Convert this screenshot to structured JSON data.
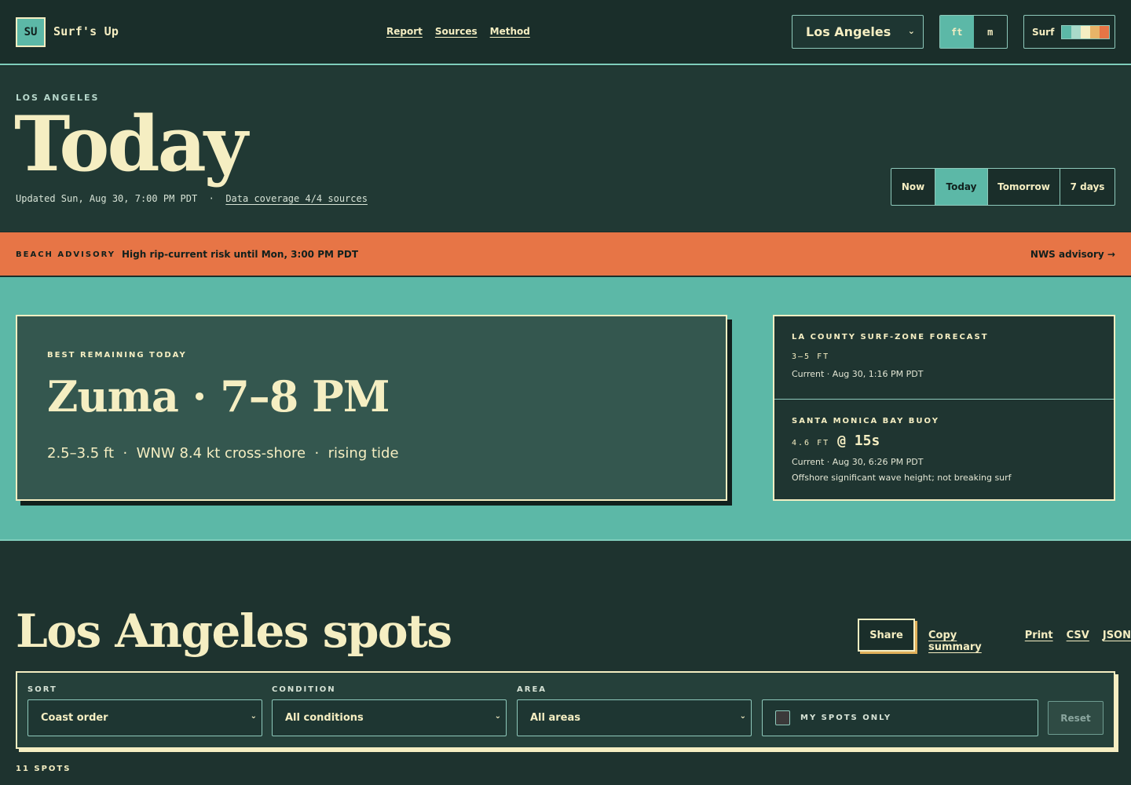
{
  "brand": {
    "logo": "SU",
    "name": "Surf's Up"
  },
  "nav": [
    {
      "label": "Report"
    },
    {
      "label": "Sources"
    },
    {
      "label": "Method"
    }
  ],
  "city_select": {
    "value": "Los Angeles"
  },
  "units": {
    "options": [
      "ft",
      "m"
    ],
    "selected": "ft"
  },
  "surf_legend": {
    "label": "Surf",
    "colors": [
      "#5cb8a7",
      "#a9dac9",
      "#f5eec2",
      "#e8b468",
      "#e77546"
    ]
  },
  "hero": {
    "eyebrow": "LOS ANGELES",
    "title": "Today",
    "updated": "Updated Sun, Aug 30, 7:00 PM PDT",
    "separator": "·",
    "coverage": "Data coverage 4/4 sources"
  },
  "range_tabs": [
    {
      "label": "Now"
    },
    {
      "label": "Today"
    },
    {
      "label": "Tomorrow"
    },
    {
      "label": "7 days"
    }
  ],
  "range_selected": "Today",
  "advisory": {
    "label": "BEACH ADVISORY",
    "message": "High rip-current risk until Mon, 3:00 PM PDT",
    "link": "NWS advisory →"
  },
  "best": {
    "eyebrow": "BEST REMAINING TODAY",
    "headline": "Zuma · 7–8 PM",
    "details": "2.5–3.5 ft  ·  WNW 8.4 kt cross-shore  ·  rising tide"
  },
  "forecast": {
    "title": "LA COUNTY SURF-ZONE FORECAST",
    "value": "3–5 FT",
    "meta": "Current · Aug 30, 1:16 PM PDT"
  },
  "buoy": {
    "title": "SANTA MONICA BAY BUOY",
    "height": "4.6 FT",
    "period": "@ 15s",
    "meta": "Current · Aug 30, 6:26 PM PDT",
    "note": "Offshore significant wave height; not breaking surf"
  },
  "spots": {
    "title": "Los Angeles spots",
    "share": "Share",
    "actions": [
      {
        "label": "Copy summary"
      },
      {
        "label": "Print"
      },
      {
        "label": "CSV"
      },
      {
        "label": "JSON"
      }
    ],
    "count": "11 SPOTS"
  },
  "filters": {
    "sort": {
      "label": "SORT",
      "value": "Coast order"
    },
    "condition": {
      "label": "CONDITION",
      "value": "All conditions"
    },
    "area": {
      "label": "AREA",
      "value": "All areas"
    },
    "my_spots": "MY SPOTS ONLY",
    "reset": "Reset"
  }
}
